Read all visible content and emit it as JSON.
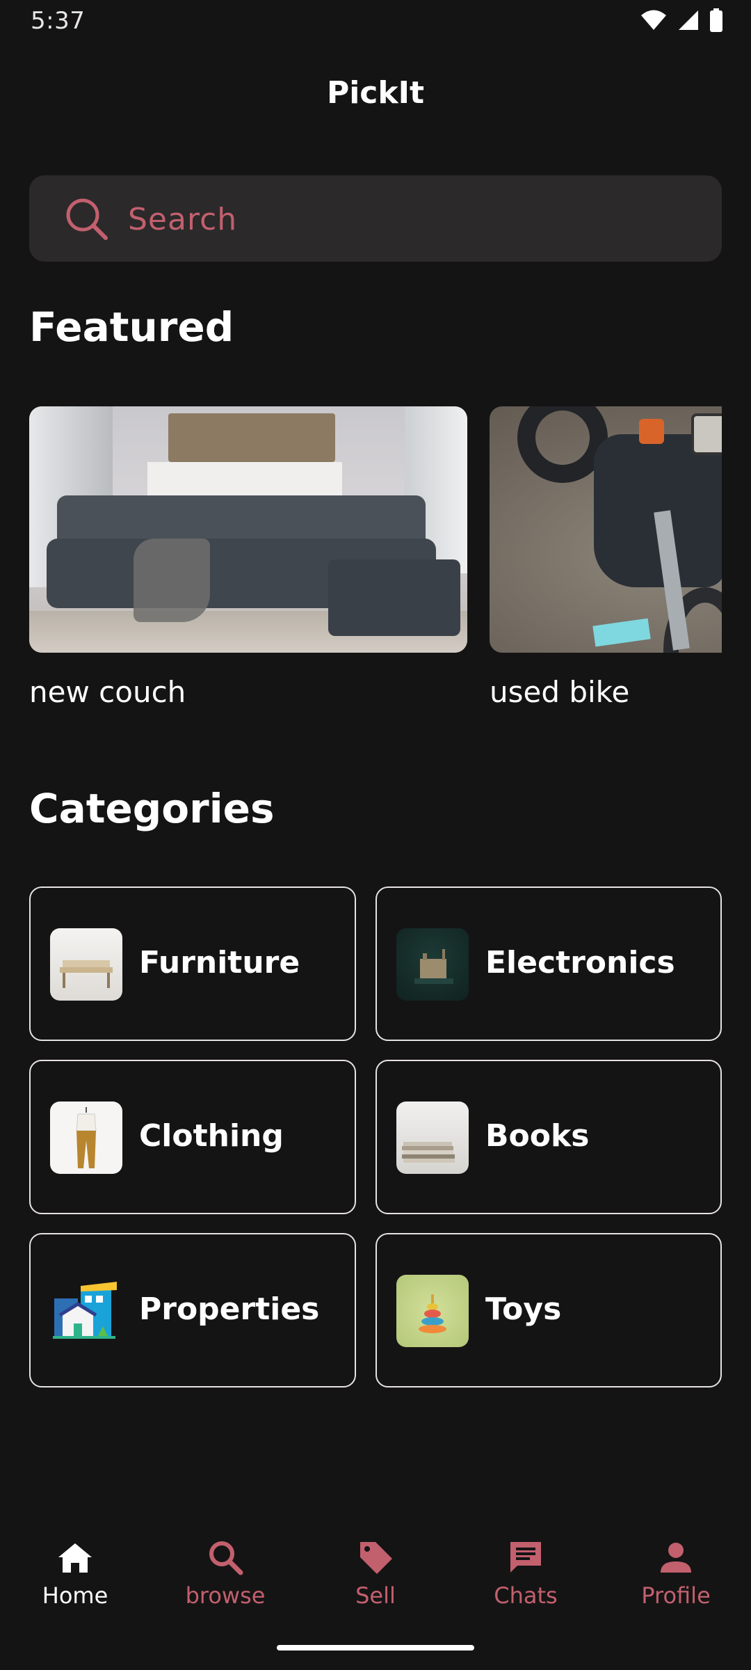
{
  "status_bar": {
    "time": "5:37"
  },
  "app_bar": {
    "title": "PickIt"
  },
  "search": {
    "placeholder": "Search"
  },
  "featured": {
    "title": "Featured",
    "items": [
      {
        "label": "new couch",
        "image": "couch-photo"
      },
      {
        "label": "used bike",
        "image": "motorbike-photo"
      }
    ]
  },
  "categories": {
    "title": "Categories",
    "items": [
      {
        "label": "Furniture",
        "icon": "bench-thumbnail"
      },
      {
        "label": "Electronics",
        "icon": "electronics-thumbnail"
      },
      {
        "label": "Clothing",
        "icon": "clothing-thumbnail"
      },
      {
        "label": "Books",
        "icon": "books-thumbnail"
      },
      {
        "label": "Properties",
        "icon": "house-thumbnail"
      },
      {
        "label": "Toys",
        "icon": "toy-thumbnail"
      }
    ]
  },
  "bottom_nav": {
    "items": [
      {
        "label": "Home",
        "icon": "home-icon",
        "active": true
      },
      {
        "label": "browse",
        "icon": "search-icon",
        "active": false
      },
      {
        "label": "Sell",
        "icon": "tag-icon",
        "active": false
      },
      {
        "label": "Chats",
        "icon": "chat-icon",
        "active": false
      },
      {
        "label": "Profile",
        "icon": "person-icon",
        "active": false
      }
    ]
  },
  "colors": {
    "background": "#151415",
    "surface": "#2b292a",
    "accent": "#c2606e",
    "text": "#ffffff",
    "card_border": "#e7e2e3"
  }
}
